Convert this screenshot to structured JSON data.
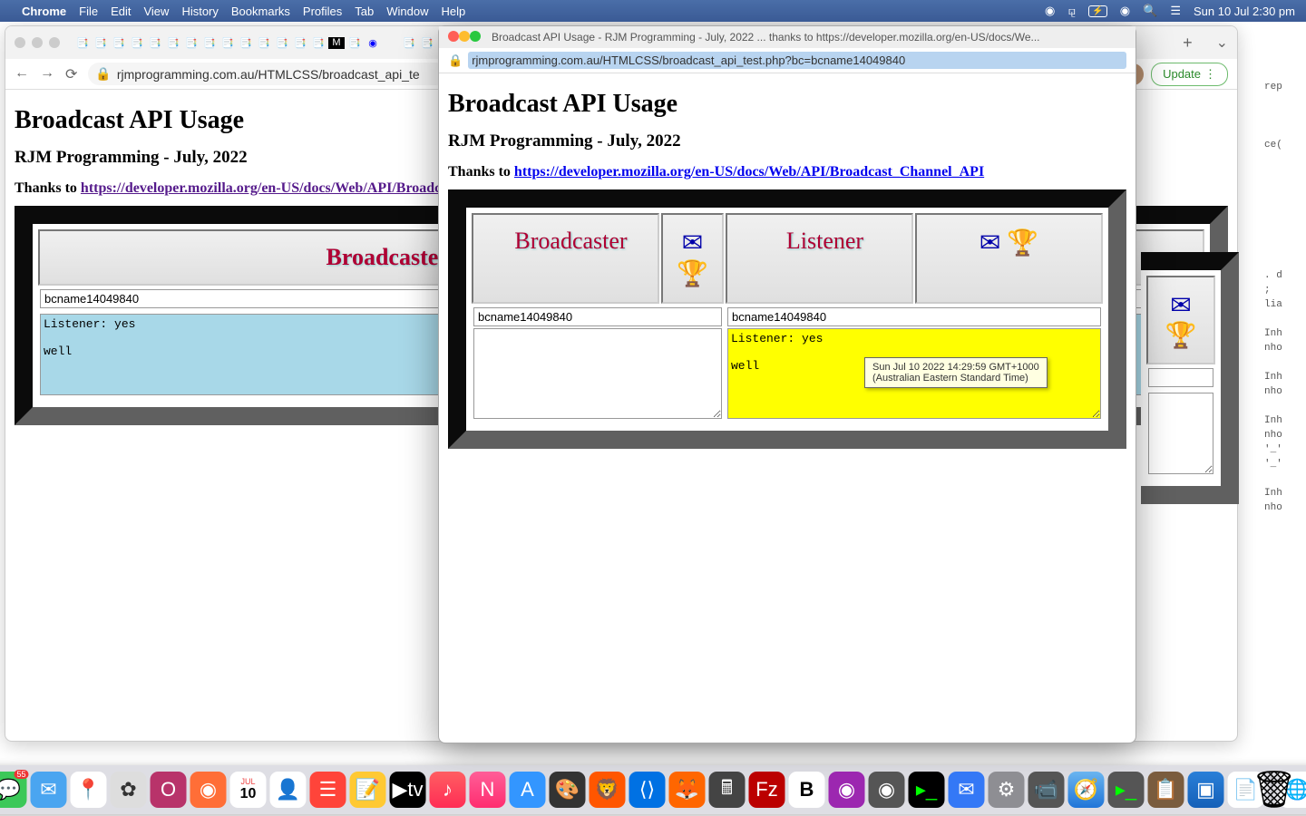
{
  "menubar": {
    "app": "Chrome",
    "menus": [
      "File",
      "Edit",
      "View",
      "History",
      "Bookmarks",
      "Profiles",
      "Tab",
      "Window",
      "Help"
    ],
    "datetime": "Sun 10 Jul  2:30 pm"
  },
  "background_window": {
    "url": "rjmprogramming.com.au/HTMLCSS/broadcast_api_te",
    "update_label": "Update",
    "page": {
      "h1": "Broadcast API Usage",
      "h2": "RJM Programming - July, 2022",
      "thanks_prefix": "Thanks to ",
      "thanks_link": "https://developer.mozilla.org/en-US/docs/Web/API/Broadcas",
      "broadcaster_label": "Broadcaster",
      "bcname": "bcname14049840",
      "textarea": "Listener: yes\n\nwell"
    }
  },
  "foreground_window": {
    "title": "Broadcast API Usage - RJM Programming - July, 2022 ... thanks to https://developer.mozilla.org/en-US/docs/We...",
    "url": "rjmprogramming.com.au/HTMLCSS/broadcast_api_test.php?bc=bcname14049840",
    "page": {
      "h1": "Broadcast API Usage",
      "h2": "RJM Programming - July, 2022",
      "thanks_prefix": "Thanks to ",
      "thanks_link": "https://developer.mozilla.org/en-US/docs/Web/API/Broadcast_Channel_API",
      "broadcaster_label": "Broadcaster",
      "listener_label": "Listener",
      "bcname_left": "bcname14049840",
      "bcname_right": "bcname14049840",
      "textarea_right": "Listener: yes\n\nwell"
    }
  },
  "tooltip": "Sun Jul 10 2022 14:29:59 GMT+1000\n(Australian Eastern Standard Time)",
  "code_edge_lines": [
    "rep",
    "",
    "",
    "",
    "ce(",
    "",
    "",
    "",
    ". d",
    ";",
    "lia",
    "",
    "Inh",
    "nho",
    "",
    "Inh",
    "nho",
    "",
    "Inh",
    "nho",
    "'_'",
    "'_'",
    "",
    "Inh",
    "nho"
  ],
  "dock_badges": {
    "messages": "55",
    "calendar": "10"
  }
}
